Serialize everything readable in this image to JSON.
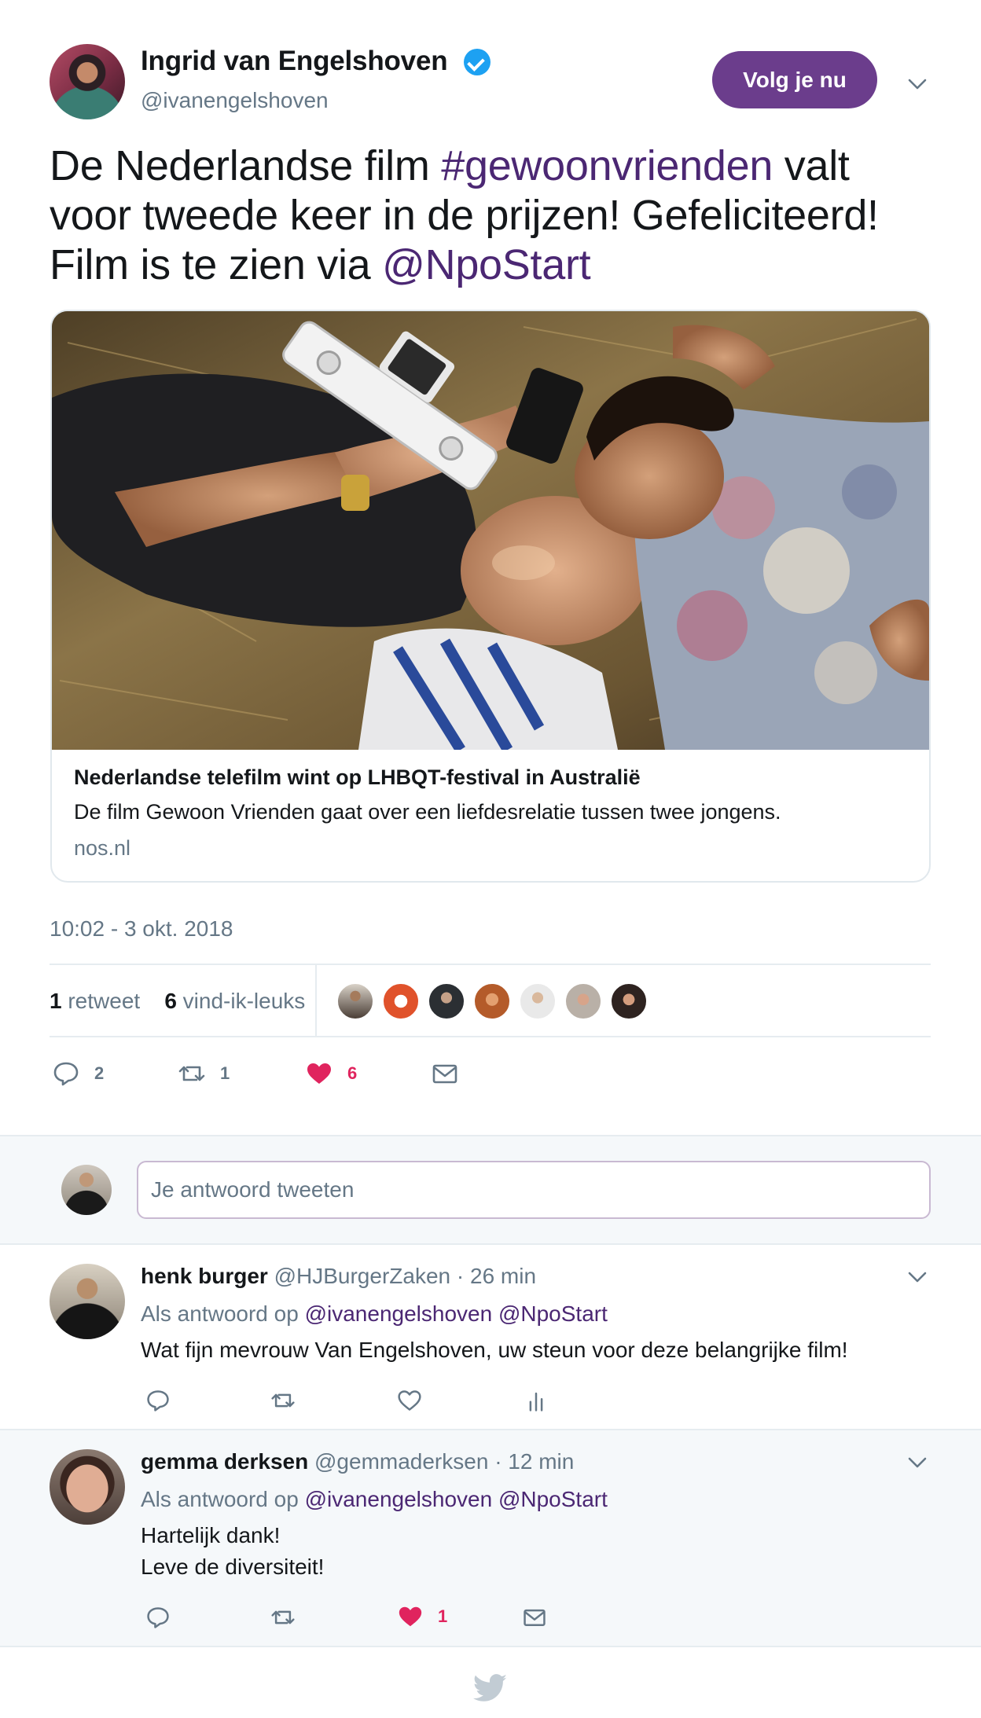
{
  "colors": {
    "link": "#4b2773",
    "follow_button": "#6b3d8c",
    "like": "#e0245e",
    "muted": "#657786",
    "verified": "#1da1f2"
  },
  "tweet": {
    "author_name": "Ingrid van Engelshoven",
    "author_handle": "@ivanengelshoven",
    "verified_icon": "verified-badge-icon",
    "follow_label": "Volg je nu",
    "text_line1_a": "De Nederlandse film ",
    "text_hashtag": "#gewoonvrienden",
    "text_line1_b": " valt",
    "text_line2": "voor tweede keer in de prijzen! Gefeliciteerd!",
    "text_line3_a": "Film is te zien via ",
    "text_mention": "@NpoStart",
    "card": {
      "title": "Nederlandse telefilm wint op LHBQT-festival in Australië",
      "description": "De film Gewoon Vrienden gaat over een liefdesrelatie tussen twee jongens.",
      "domain": "nos.nl"
    },
    "timestamp": "10:02 - 3 okt. 2018",
    "retweet_count": "1",
    "retweet_label": "retweet",
    "like_count": "6",
    "like_label": "vind-ik-leuks",
    "actions": {
      "reply_count": "2",
      "retweet_count": "1",
      "like_count": "6"
    }
  },
  "composer": {
    "placeholder": "Je antwoord tweeten"
  },
  "replies": [
    {
      "name": "henk burger",
      "handle": "@HJBurgerZaken",
      "time": "· 26 min",
      "reply_to_prefix": "Als antwoord op",
      "reply_to_1": "@ivanengelshoven",
      "reply_to_2": "@NpoStart",
      "line1": "Wat fijn mevrouw Van Engelshoven, uw steun voor deze belangrijke film!"
    },
    {
      "name": "gemma derksen",
      "handle": "@gemmaderksen",
      "time": "· 12 min",
      "reply_to_prefix": "Als antwoord op",
      "reply_to_1": "@ivanengelshoven",
      "reply_to_2": "@NpoStart",
      "line1": "Hartelijk dank!",
      "line2": "Leve de diversiteit!",
      "like_count": "1"
    }
  ]
}
